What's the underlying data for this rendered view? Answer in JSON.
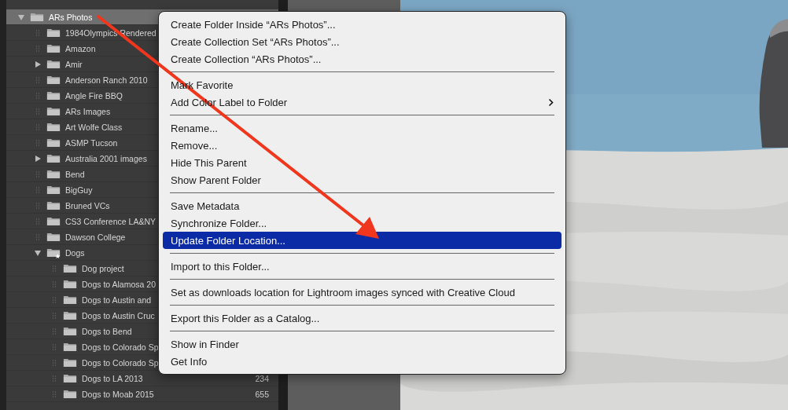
{
  "folder_tree": {
    "items": [
      {
        "label": "ARs Photos",
        "selected": true,
        "expanded": true,
        "children": [
          {
            "label": "1984Olympics Rendered",
            "selected": false
          },
          {
            "label": "Amazon",
            "selected": false
          },
          {
            "label": "Amir",
            "selected": false,
            "expanded": false
          },
          {
            "label": "Anderson Ranch 2010",
            "selected": false
          },
          {
            "label": "Angle Fire BBQ",
            "selected": false
          },
          {
            "label": "ARs Images",
            "selected": false
          },
          {
            "label": "Art Wolfe Class",
            "selected": false
          },
          {
            "label": "ASMP Tucson",
            "selected": false
          },
          {
            "label": "Australia 2001 images",
            "selected": false,
            "expanded": false
          },
          {
            "label": "Bend",
            "selected": false
          },
          {
            "label": "BigGuy",
            "selected": false
          },
          {
            "label": "Bruned VCs",
            "selected": false
          },
          {
            "label": "CS3 Conference LA&NY",
            "selected": false
          },
          {
            "label": "Dawson College",
            "selected": false
          },
          {
            "label": "Dogs",
            "selected": false,
            "expanded": true,
            "favorite": true,
            "children": [
              {
                "label": "Dog project",
                "selected": false
              },
              {
                "label": "Dogs to Alamosa 20",
                "selected": false
              },
              {
                "label": "Dogs to Austin and",
                "selected": false
              },
              {
                "label": "Dogs to Austin Cruc",
                "selected": false
              },
              {
                "label": "Dogs to Bend",
                "selected": false
              },
              {
                "label": "Dogs to Colorado Sp",
                "selected": false
              },
              {
                "label": "Dogs to Colorado Sp",
                "selected": false
              },
              {
                "label": "Dogs to LA 2013",
                "selected": false,
                "count": "234"
              },
              {
                "label": "Dogs to Moab 2015",
                "selected": false,
                "count": "655"
              }
            ]
          }
        ]
      }
    ]
  },
  "context_menu": {
    "items": [
      {
        "kind": "item",
        "label": "Create Folder Inside “ARs Photos”...",
        "selected": false
      },
      {
        "kind": "item",
        "label": "Create Collection Set “ARs Photos”...",
        "selected": false
      },
      {
        "kind": "item",
        "label": "Create Collection “ARs Photos”...",
        "selected": false
      },
      {
        "kind": "separator"
      },
      {
        "kind": "item",
        "label": "Mark Favorite",
        "selected": false
      },
      {
        "kind": "item",
        "label": "Add Color Label to Folder",
        "selected": false,
        "submenu": true
      },
      {
        "kind": "separator"
      },
      {
        "kind": "item",
        "label": "Rename...",
        "selected": false
      },
      {
        "kind": "item",
        "label": "Remove...",
        "selected": false
      },
      {
        "kind": "item",
        "label": "Hide This Parent",
        "selected": false
      },
      {
        "kind": "item",
        "label": "Show Parent Folder",
        "selected": false
      },
      {
        "kind": "separator"
      },
      {
        "kind": "item",
        "label": "Save Metadata",
        "selected": false
      },
      {
        "kind": "item",
        "label": "Synchronize Folder...",
        "selected": false
      },
      {
        "kind": "item",
        "label": "Update Folder Location...",
        "selected": true
      },
      {
        "kind": "separator"
      },
      {
        "kind": "item",
        "label": "Import to this Folder...",
        "selected": false
      },
      {
        "kind": "separator"
      },
      {
        "kind": "item",
        "label": "Set as downloads location for Lightroom images synced with Creative Cloud",
        "selected": false
      },
      {
        "kind": "separator"
      },
      {
        "kind": "item",
        "label": "Export this Folder as a Catalog...",
        "selected": false
      },
      {
        "kind": "separator"
      },
      {
        "kind": "item",
        "label": "Show in Finder",
        "selected": false
      },
      {
        "kind": "item",
        "label": "Get Info",
        "selected": false
      }
    ]
  }
}
